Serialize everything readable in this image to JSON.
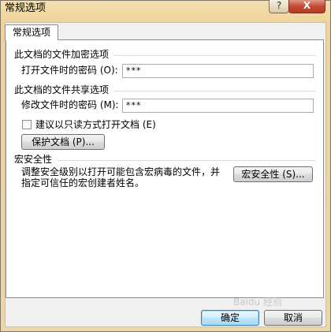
{
  "window": {
    "title": "常规选项",
    "help_label": "?",
    "close_label": "X"
  },
  "tab": {
    "label": "常规选项"
  },
  "encryption": {
    "section_title": "此文档的文件加密选项",
    "open_password_label": "打开文件时的密码 (O):",
    "open_password_value": "***"
  },
  "sharing": {
    "section_title": "此文档的文件共享选项",
    "modify_password_label": "修改文件时的密码 (M):",
    "modify_password_value": "***",
    "readonly_recommend_label": "建议以只读方式打开文档 (E)",
    "readonly_recommend_checked": false,
    "protect_button_label": "保护文档 (P)..."
  },
  "macro": {
    "section_title": "宏安全性",
    "description": "调整安全级别以打开可能包含宏病毒的文件，并指定可信任的宏创建者姓名。",
    "button_label": "宏安全性 (S)..."
  },
  "footer": {
    "ok_label": "确定",
    "cancel_label": "取消"
  },
  "watermark": "Baidu 经验"
}
